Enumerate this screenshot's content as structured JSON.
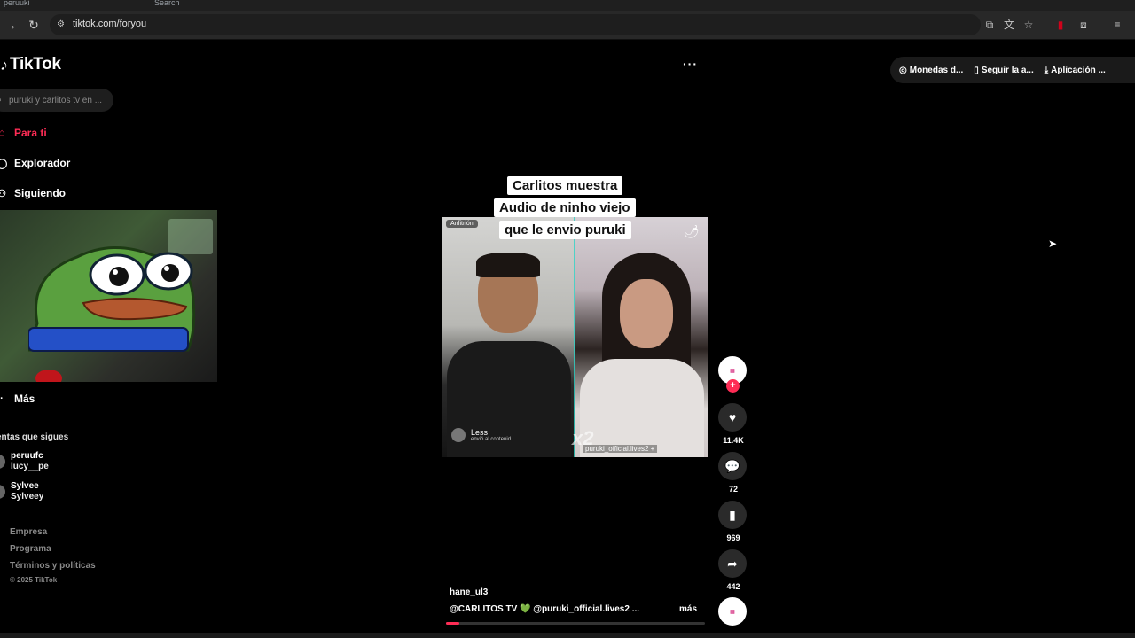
{
  "browser": {
    "url": "tiktok.com/foryou",
    "tabs": [
      "peruuki",
      "Search"
    ]
  },
  "tiktok": {
    "logo_text": "TikTok",
    "search_placeholder": "puruki y carlitos tv en ...",
    "menu": {
      "for_you": "Para ti",
      "explore": "Explorador",
      "following": "Siguiendo",
      "more": "Más"
    },
    "following_section": "entas que sigues",
    "accounts": [
      {
        "name": "peruufc",
        "handle": "lucy__pe"
      },
      {
        "name": "Sylvee",
        "handle": "Sylveey"
      }
    ],
    "footer": [
      "Empresa",
      "Programa",
      "Términos y políticas"
    ],
    "copyright": "© 2025 TikTok",
    "top_actions": {
      "coins": "Monedas d...",
      "follow_app": "Seguir la a...",
      "app": "Aplicación ..."
    }
  },
  "video": {
    "caption_lines": [
      "Carlitos muestra",
      "Audio de ninho viejo",
      "que le envio puruki"
    ],
    "host_badge": "Anfitrión",
    "left_user": "Less",
    "left_user_sub": "envió al contenid...",
    "multiplier": "x2",
    "right_tag": "puruki_official.lives2 +",
    "author": "hane_ul3",
    "description": "@CARLITOS TV 💚 @puruki_official.lives2 ...",
    "more_label": "más",
    "progress": 0.05
  },
  "rail": {
    "likes": "11.4K",
    "comments": "72",
    "saves": "969",
    "shares": "442"
  },
  "colors": {
    "accent": "#fe2c55",
    "background": "#000000"
  }
}
